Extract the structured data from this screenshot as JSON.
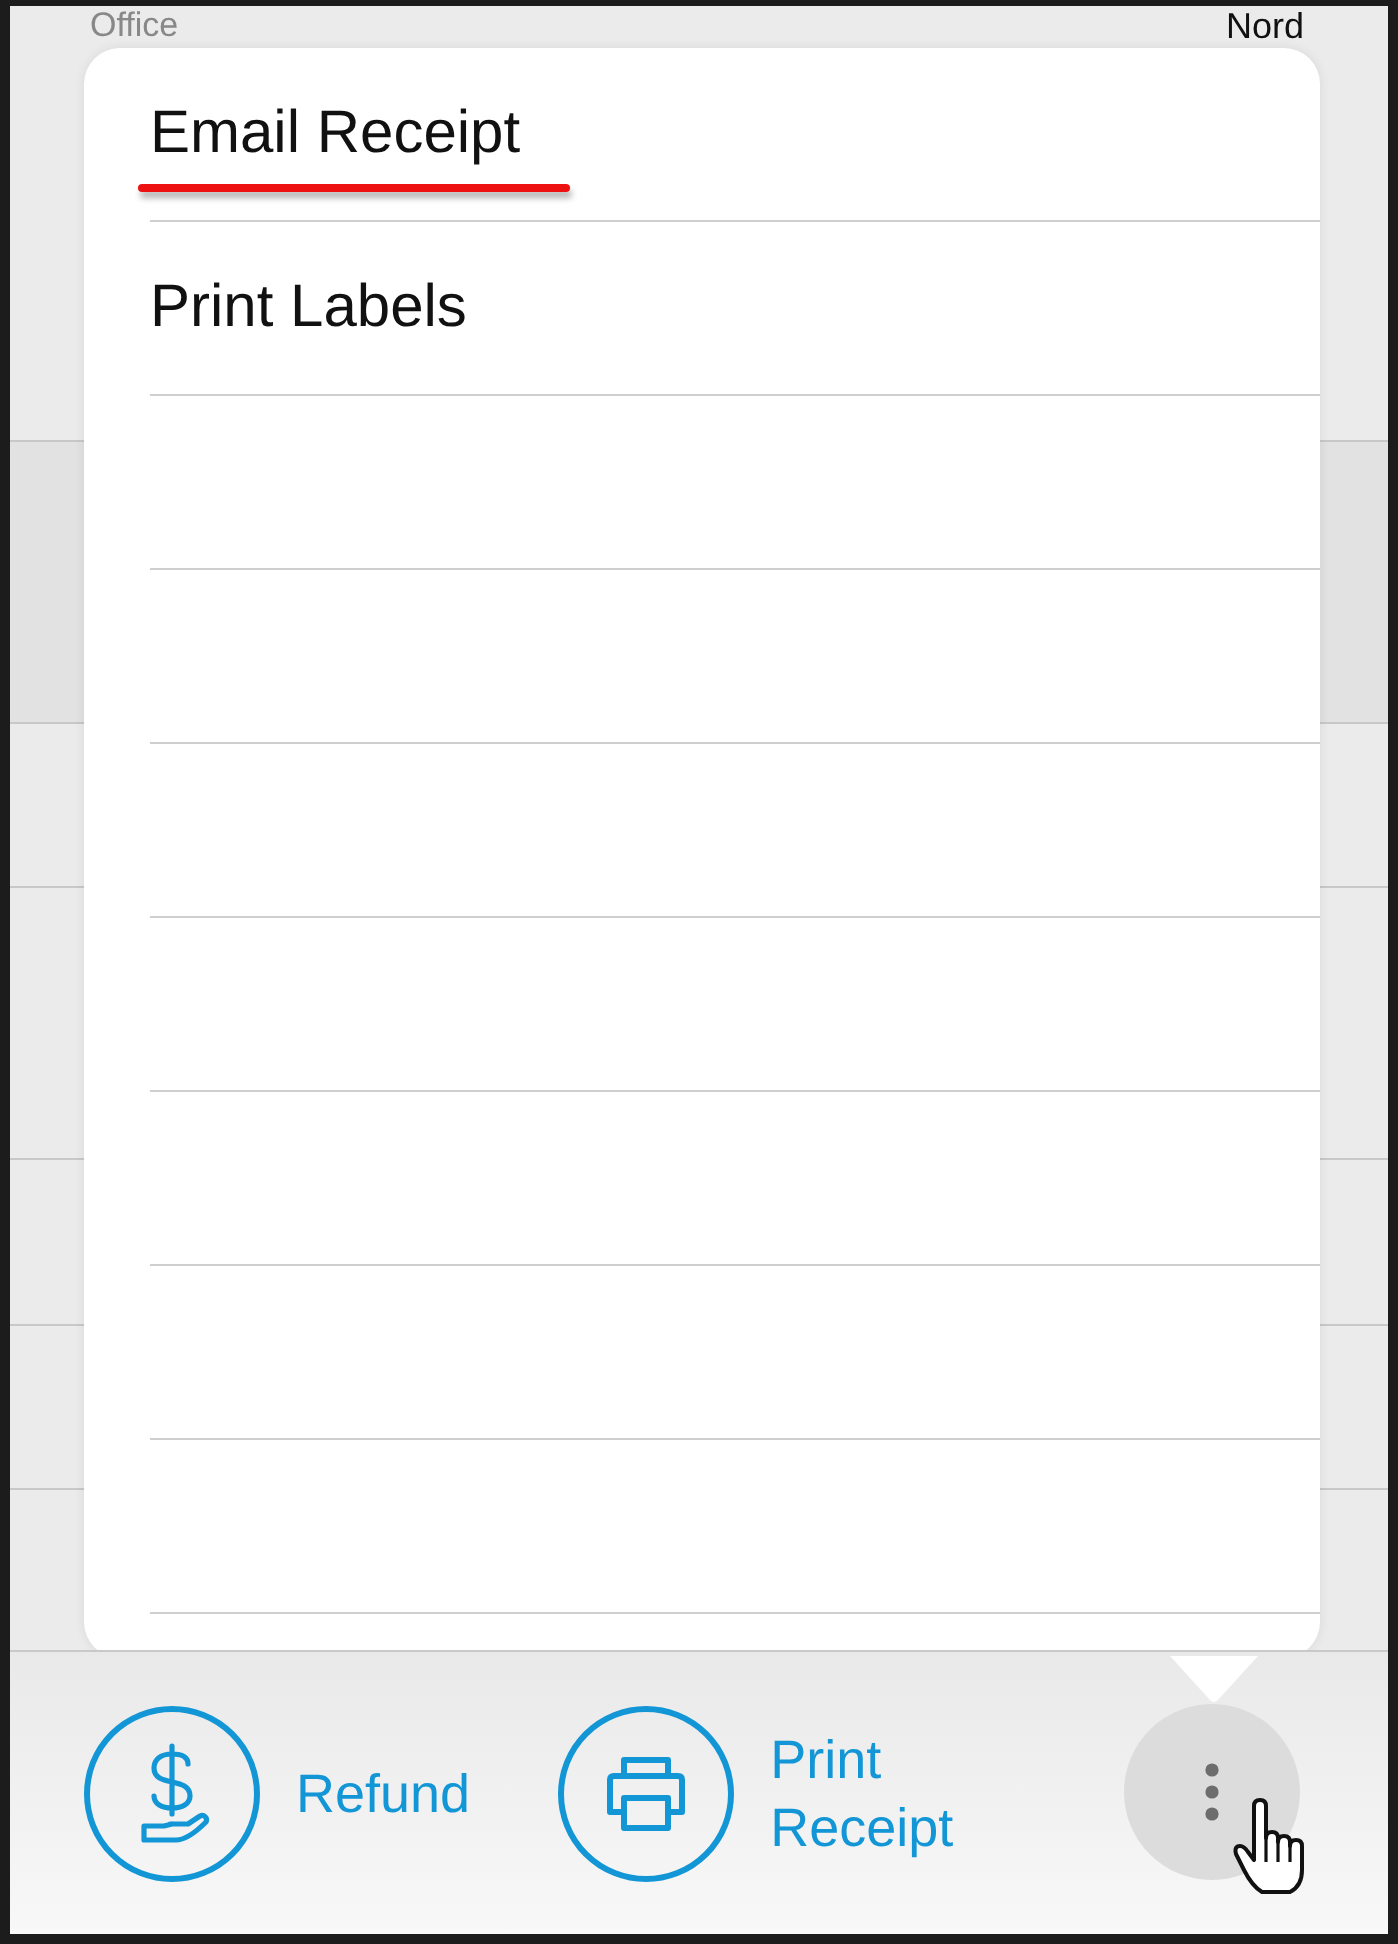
{
  "background": {
    "left_label": "Office",
    "right_label": "Nord"
  },
  "menu": {
    "items": [
      {
        "label": "Email Receipt",
        "underlined": true
      },
      {
        "label": "Print Labels",
        "underlined": false
      }
    ]
  },
  "toolbar": {
    "buttons": [
      {
        "kind": "refund",
        "label": "Refund"
      },
      {
        "kind": "print",
        "label": "Print Receipt"
      }
    ],
    "more_pressed": true
  }
}
